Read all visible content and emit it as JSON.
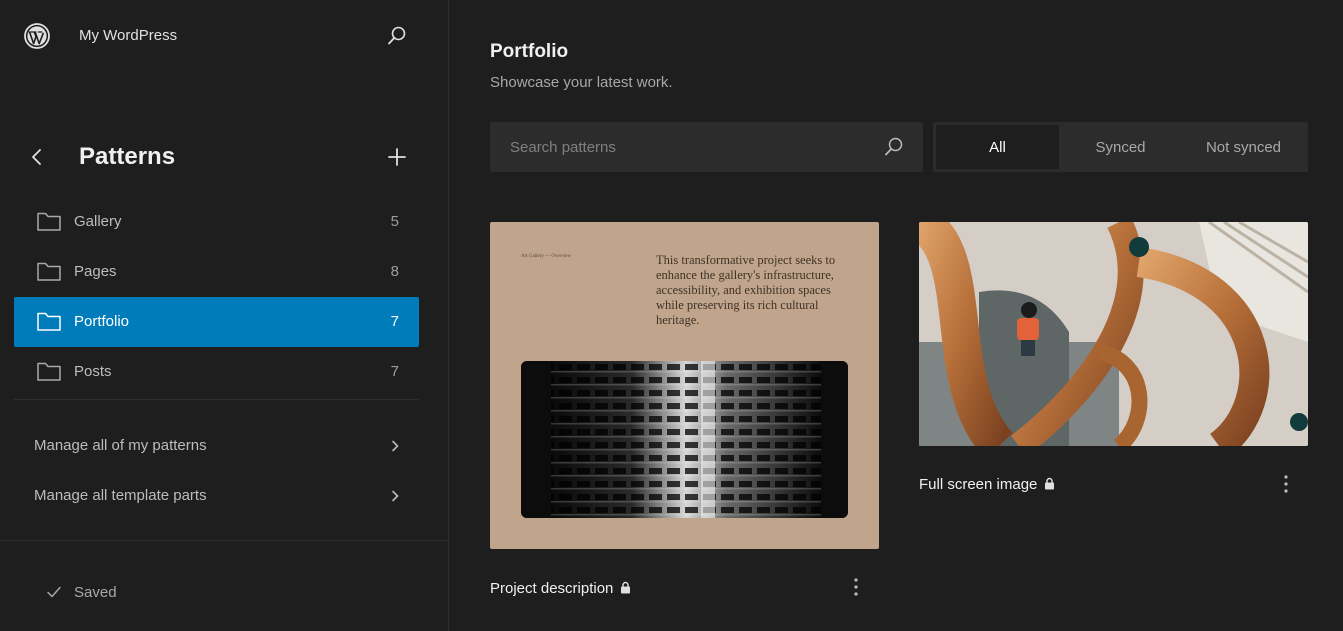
{
  "site": {
    "name": "My WordPress"
  },
  "sidebar": {
    "title": "Patterns",
    "categories": [
      {
        "label": "Gallery",
        "count": "5"
      },
      {
        "label": "Pages",
        "count": "8"
      },
      {
        "label": "Portfolio",
        "count": "7"
      },
      {
        "label": "Posts",
        "count": "7"
      }
    ],
    "active_category": "Portfolio",
    "links": [
      {
        "label": "Manage all of my patterns"
      },
      {
        "label": "Manage all template parts"
      }
    ],
    "status": "Saved"
  },
  "main": {
    "title": "Portfolio",
    "subtitle": "Showcase your latest work.",
    "search": {
      "placeholder": "Search patterns"
    },
    "filters": [
      {
        "label": "All"
      },
      {
        "label": "Synced"
      },
      {
        "label": "Not synced"
      }
    ],
    "active_filter": "All",
    "patterns": [
      {
        "title": "Project description",
        "preview_small_text": "Art Gallery — Overview",
        "preview_text": "This transformative project seeks to enhance the gallery's infrastructure, accessibility, and exhibition spaces while preserving its rich cultural heritage.",
        "locked": true
      },
      {
        "title": "Full screen image",
        "locked": true
      }
    ]
  },
  "colors": {
    "accent": "#007cba",
    "background": "#1e1e1e",
    "surface": "#2c2c2c",
    "card_beige": "#c0a58c"
  }
}
